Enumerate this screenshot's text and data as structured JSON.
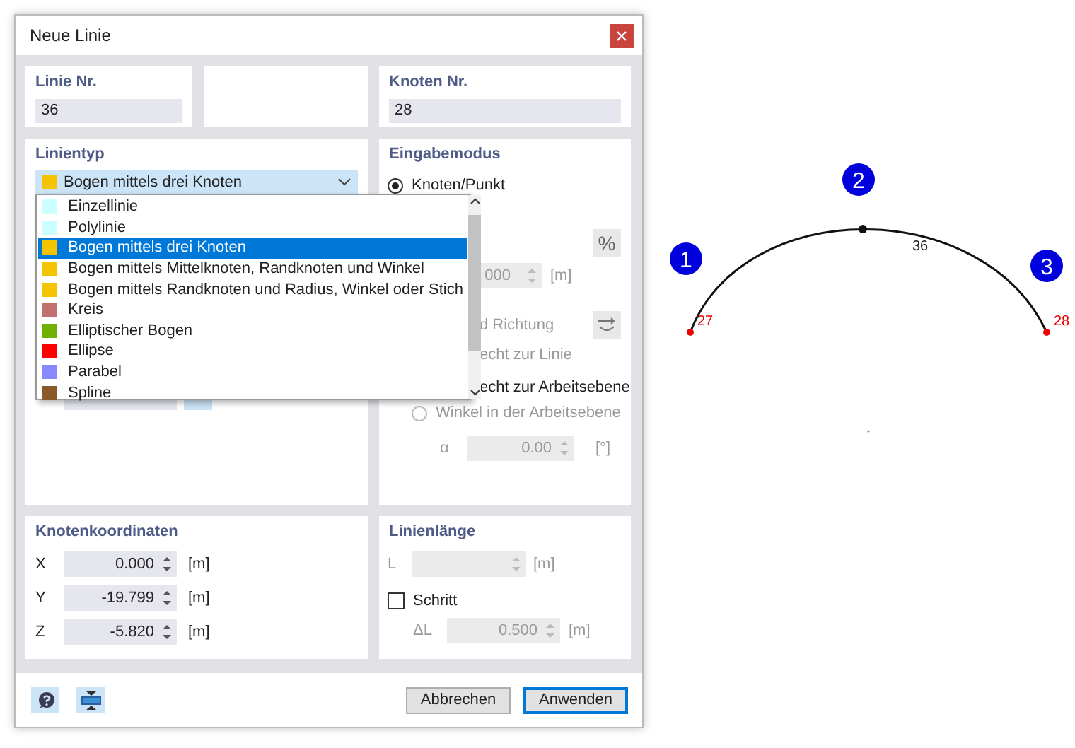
{
  "window": {
    "title": "Neue Linie"
  },
  "line_no": {
    "label": "Linie Nr.",
    "value": "36"
  },
  "node_no": {
    "label": "Knoten Nr.",
    "value": "28"
  },
  "line_type": {
    "label": "Linientyp",
    "value": "Bogen mittels drei Knoten",
    "color": "#f5c400",
    "expanded": true,
    "items": [
      {
        "label": "Einzellinie",
        "color": "#ccffff",
        "selected": false
      },
      {
        "label": "Polylinie",
        "color": "#ccffff",
        "selected": false
      },
      {
        "label": "Bogen mittels drei Knoten",
        "color": "#f5c400",
        "selected": true
      },
      {
        "label": "Bogen mittels Mittelknoten, Randknoten und Winkel",
        "color": "#f5c400",
        "selected": false
      },
      {
        "label": "Bogen mittels Randknoten und Radius, Winkel oder Stich",
        "color": "#f5c400",
        "selected": false
      },
      {
        "label": "Kreis",
        "color": "#c07070",
        "selected": false
      },
      {
        "label": "Elliptischer Bogen",
        "color": "#70b000",
        "selected": false
      },
      {
        "label": "Ellipse",
        "color": "#ff0000",
        "selected": false
      },
      {
        "label": "Parabel",
        "color": "#8888ff",
        "selected": false
      },
      {
        "label": "Spline",
        "color": "#8b5a2b",
        "selected": false
      }
    ]
  },
  "input_mode": {
    "label": "Eingabemodus",
    "node_radio": {
      "label": "Knoten/Punkt",
      "selected": true
    },
    "percent_button": "%",
    "distance": {
      "value": "000",
      "unit": "[m]"
    },
    "direction": {
      "text": "d Richtung",
      "disabled": true
    },
    "perpendicular_line": {
      "text": "echt zur Linie",
      "disabled": true
    },
    "perpendicular_plane": {
      "text": "echt zur Arbeitsebene",
      "disabled": false
    },
    "angle_radio": {
      "label": "Winkel in der Arbeitsebene",
      "selected": false,
      "disabled": true
    },
    "alpha": {
      "symbol": "α",
      "value": "0.00",
      "unit": "[°]"
    }
  },
  "coordinates": {
    "label": "Knotenkoordinaten",
    "rows": [
      {
        "axis": "X",
        "value": "0.000",
        "unit": "[m]"
      },
      {
        "axis": "Y",
        "value": "-19.799",
        "unit": "[m]"
      },
      {
        "axis": "Z",
        "value": "-5.820",
        "unit": "[m]"
      }
    ]
  },
  "length": {
    "label": "Linienlänge",
    "l": {
      "symbol": "L",
      "unit": "[m]"
    },
    "step": {
      "label": "Schritt",
      "checked": false
    },
    "delta": {
      "symbol": "ΔL",
      "value": "0.500",
      "unit": "[m]"
    }
  },
  "buttons": [
    {
      "label": "Abbrechen",
      "default": false
    },
    {
      "label": "Anwenden",
      "default": true
    }
  ],
  "canvas": {
    "markers": [
      "1",
      "2",
      "3"
    ],
    "node_labels": [
      "27",
      "28"
    ],
    "line_label": "36"
  }
}
